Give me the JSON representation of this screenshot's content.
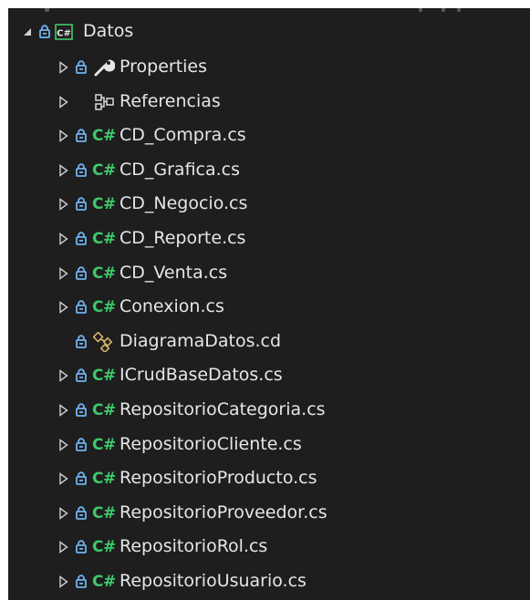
{
  "tree": {
    "project": {
      "label": "Datos",
      "icon": "csharp-project-icon"
    },
    "items": [
      {
        "label": "Properties",
        "icon": "wrench-icon",
        "expandable": true,
        "locked": true
      },
      {
        "label": "Referencias",
        "icon": "references-icon",
        "expandable": true,
        "locked": false
      },
      {
        "label": "CD_Compra.cs",
        "icon": "csharp-file-icon",
        "expandable": true,
        "locked": true
      },
      {
        "label": "CD_Grafica.cs",
        "icon": "csharp-file-icon",
        "expandable": true,
        "locked": true
      },
      {
        "label": "CD_Negocio.cs",
        "icon": "csharp-file-icon",
        "expandable": true,
        "locked": true
      },
      {
        "label": "CD_Reporte.cs",
        "icon": "csharp-file-icon",
        "expandable": true,
        "locked": true
      },
      {
        "label": "CD_Venta.cs",
        "icon": "csharp-file-icon",
        "expandable": true,
        "locked": true
      },
      {
        "label": "Conexion.cs",
        "icon": "csharp-file-icon",
        "expandable": true,
        "locked": true
      },
      {
        "label": "DiagramaDatos.cd",
        "icon": "class-diagram-icon",
        "expandable": false,
        "locked": true
      },
      {
        "label": "ICrudBaseDatos.cs",
        "icon": "csharp-file-icon",
        "expandable": true,
        "locked": true
      },
      {
        "label": "RepositorioCategoria.cs",
        "icon": "csharp-file-icon",
        "expandable": true,
        "locked": true
      },
      {
        "label": "RepositorioCliente.cs",
        "icon": "csharp-file-icon",
        "expandable": true,
        "locked": true
      },
      {
        "label": "RepositorioProducto.cs",
        "icon": "csharp-file-icon",
        "expandable": true,
        "locked": true
      },
      {
        "label": "RepositorioProveedor.cs",
        "icon": "csharp-file-icon",
        "expandable": true,
        "locked": true
      },
      {
        "label": "RepositorioRol.cs",
        "icon": "csharp-file-icon",
        "expandable": true,
        "locked": true
      },
      {
        "label": "RepositorioUsuario.cs",
        "icon": "csharp-file-icon",
        "expandable": true,
        "locked": true
      }
    ],
    "csharp_glyph": "C#"
  },
  "colors": {
    "background": "#1e1e1e",
    "text": "#e6e6e6",
    "csharp": "#3ec96b",
    "lock": "#6fb2f2",
    "expander": "#cfcfcf",
    "diagram": "#d6b36a"
  }
}
